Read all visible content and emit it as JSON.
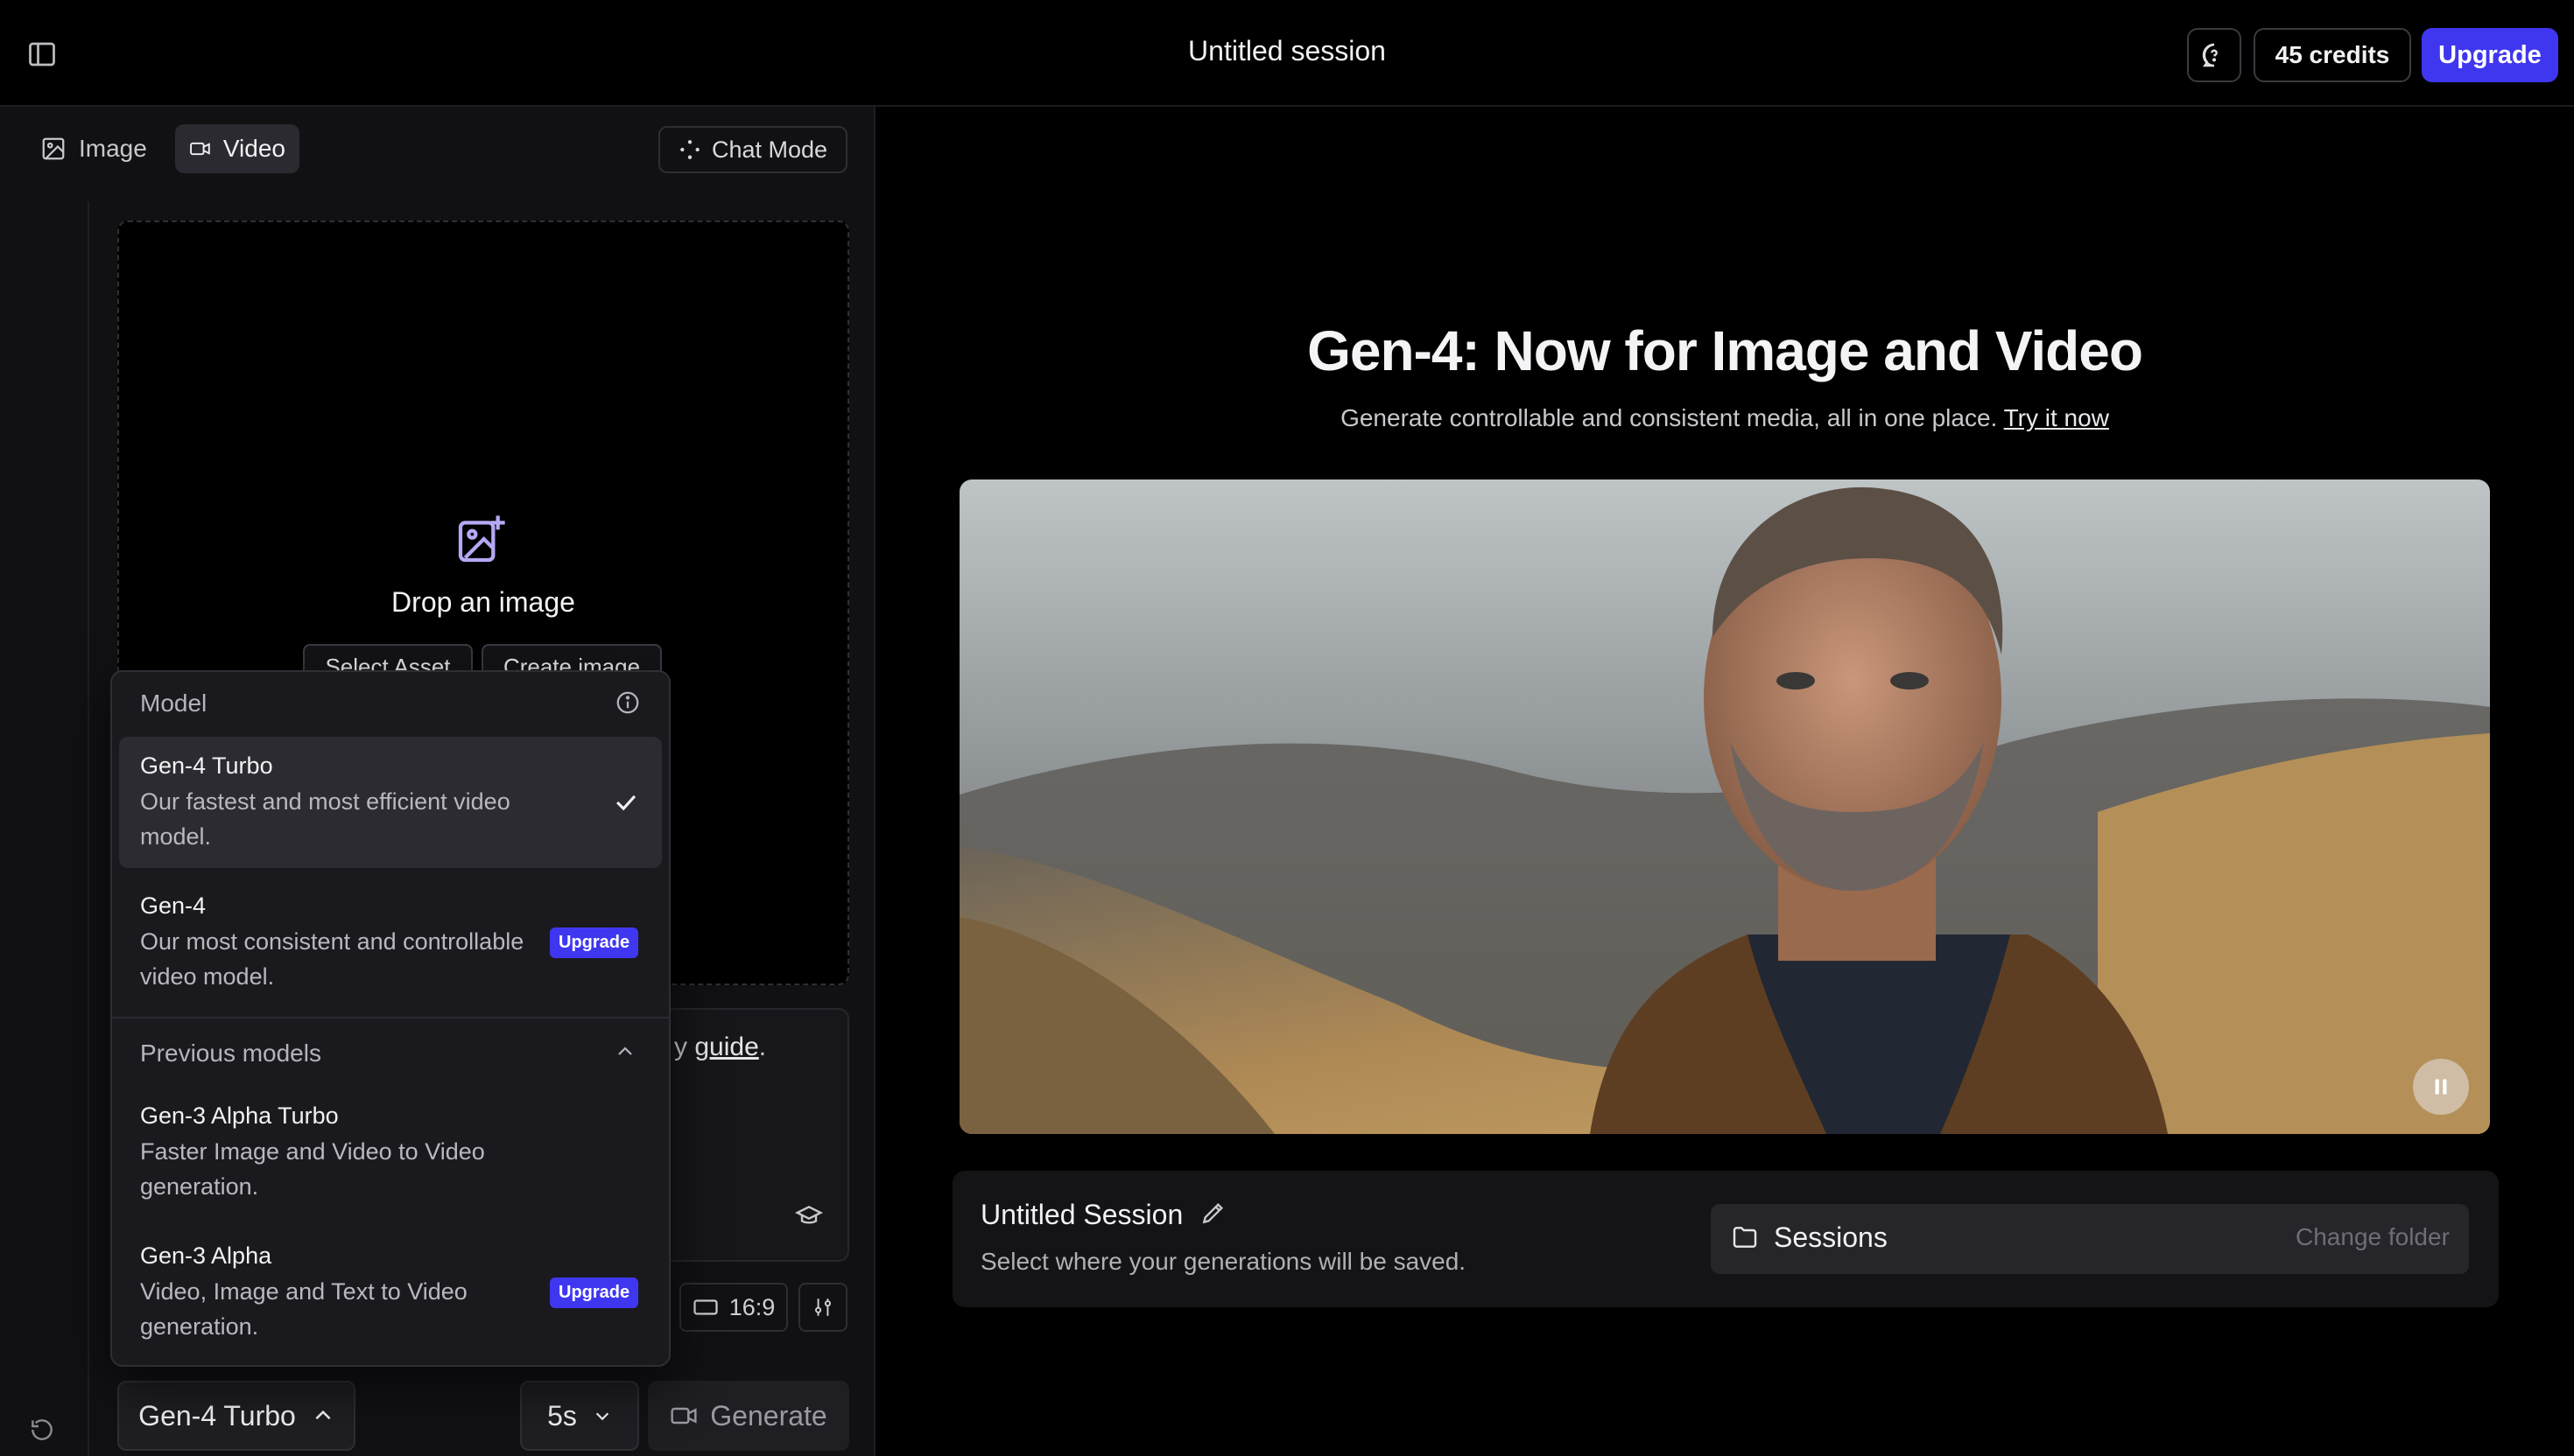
{
  "header": {
    "session_title": "Untitled session",
    "credits": "45 credits",
    "upgrade": "Upgrade"
  },
  "tabs": [
    {
      "label": "Image",
      "icon": "image-icon",
      "active": false
    },
    {
      "label": "Video",
      "icon": "video-icon",
      "active": true
    }
  ],
  "chat_mode": "Chat Mode",
  "dropzone": {
    "label": "Drop an image",
    "select_asset": "Select Asset",
    "create_image": "Create image"
  },
  "prompt": {
    "guide_prefix": "y ",
    "guide_link": "guide",
    "guide_suffix": "."
  },
  "controls": {
    "aspect_ratio": "16:9",
    "model": "Gen-4 Turbo",
    "duration": "5s",
    "generate": "Generate"
  },
  "model_menu": {
    "title": "Model",
    "options": [
      {
        "name": "Gen-4 Turbo",
        "desc": "Our fastest and most efficient video model.",
        "selected": true
      },
      {
        "name": "Gen-4",
        "desc": "Our most consistent and controllable video model.",
        "badge": "Upgrade"
      }
    ],
    "previous_title": "Previous models",
    "previous_options": [
      {
        "name": "Gen-3 Alpha Turbo",
        "desc": "Faster Image and Video to Video generation."
      },
      {
        "name": "Gen-3 Alpha",
        "desc": "Video, Image and Text to Video generation.",
        "badge": "Upgrade"
      }
    ]
  },
  "hero": {
    "title": "Gen-4: Now for Image and Video",
    "subtitle": "Generate controllable and consistent media, all in one place. ",
    "cta": "Try it now"
  },
  "session_card": {
    "title": "Untitled Session",
    "subtitle": "Select where your generations will be saved.",
    "folder": "Sessions",
    "change_folder": "Change folder"
  },
  "colors": {
    "accent": "#3f37f0",
    "background": "#000000",
    "panel": "#111114"
  }
}
